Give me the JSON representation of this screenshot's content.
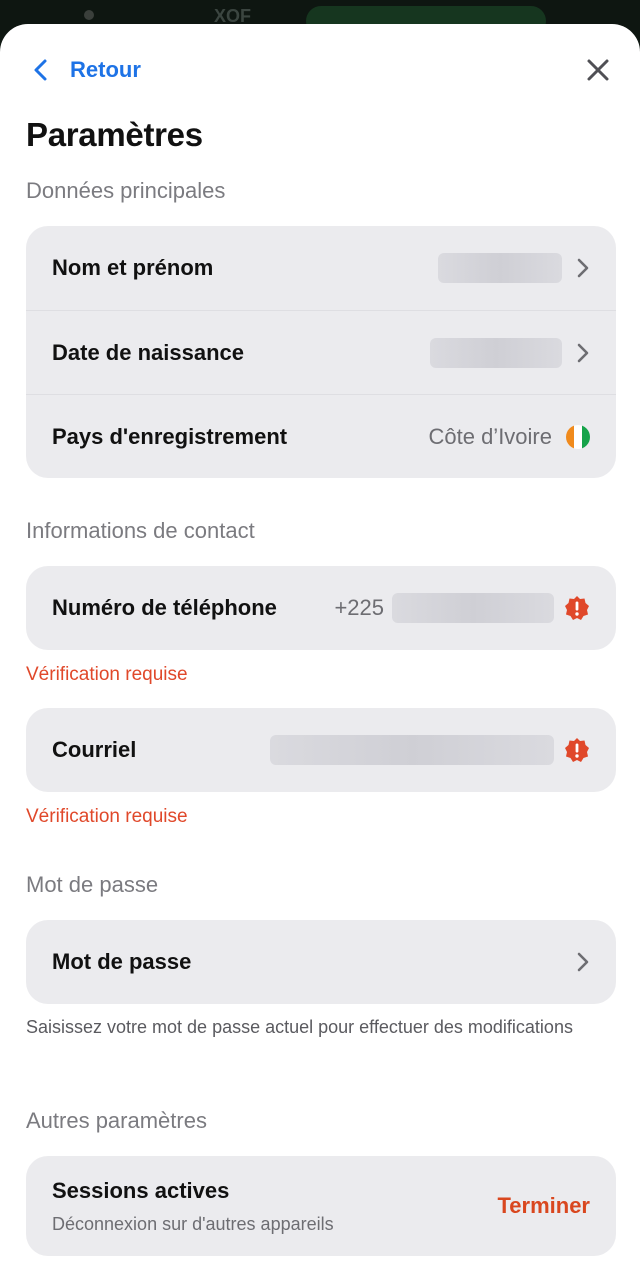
{
  "status_bar": {
    "currency": "XOF"
  },
  "header": {
    "back_label": "Retour"
  },
  "page": {
    "title": "Paramètres"
  },
  "sections": {
    "main": {
      "title": "Données principales",
      "rows": [
        {
          "label": "Nom et prénom"
        },
        {
          "label": "Date de naissance"
        },
        {
          "label": "Pays d'enregistrement",
          "value": "Côte d’Ivoire"
        }
      ]
    },
    "contact": {
      "title": "Informations de contact",
      "phone": {
        "label": "Numéro de téléphone",
        "prefix": "+225",
        "status": "Vérification requise"
      },
      "email": {
        "label": "Courriel",
        "status": "Vérification requise"
      }
    },
    "password": {
      "title": "Mot de passe",
      "label": "Mot de passe",
      "hint": "Saisissez votre mot de passe actuel pour effectuer des modifications"
    },
    "other": {
      "title": "Autres paramètres",
      "sessions_title": "Sessions actives",
      "sessions_subtitle": "Déconnexion sur d'autres appareils",
      "terminate_label": "Terminer"
    }
  },
  "colors": {
    "accent": "#1e73e6",
    "warning": "#e0482a",
    "card": "#ebebee",
    "flag": [
      "#f08a1c",
      "#ffffff",
      "#16a34a"
    ]
  },
  "icons": [
    "chevron-left-icon",
    "close-icon",
    "chevron-right-icon",
    "ivory-coast-flag-icon",
    "alert-badge-icon"
  ]
}
